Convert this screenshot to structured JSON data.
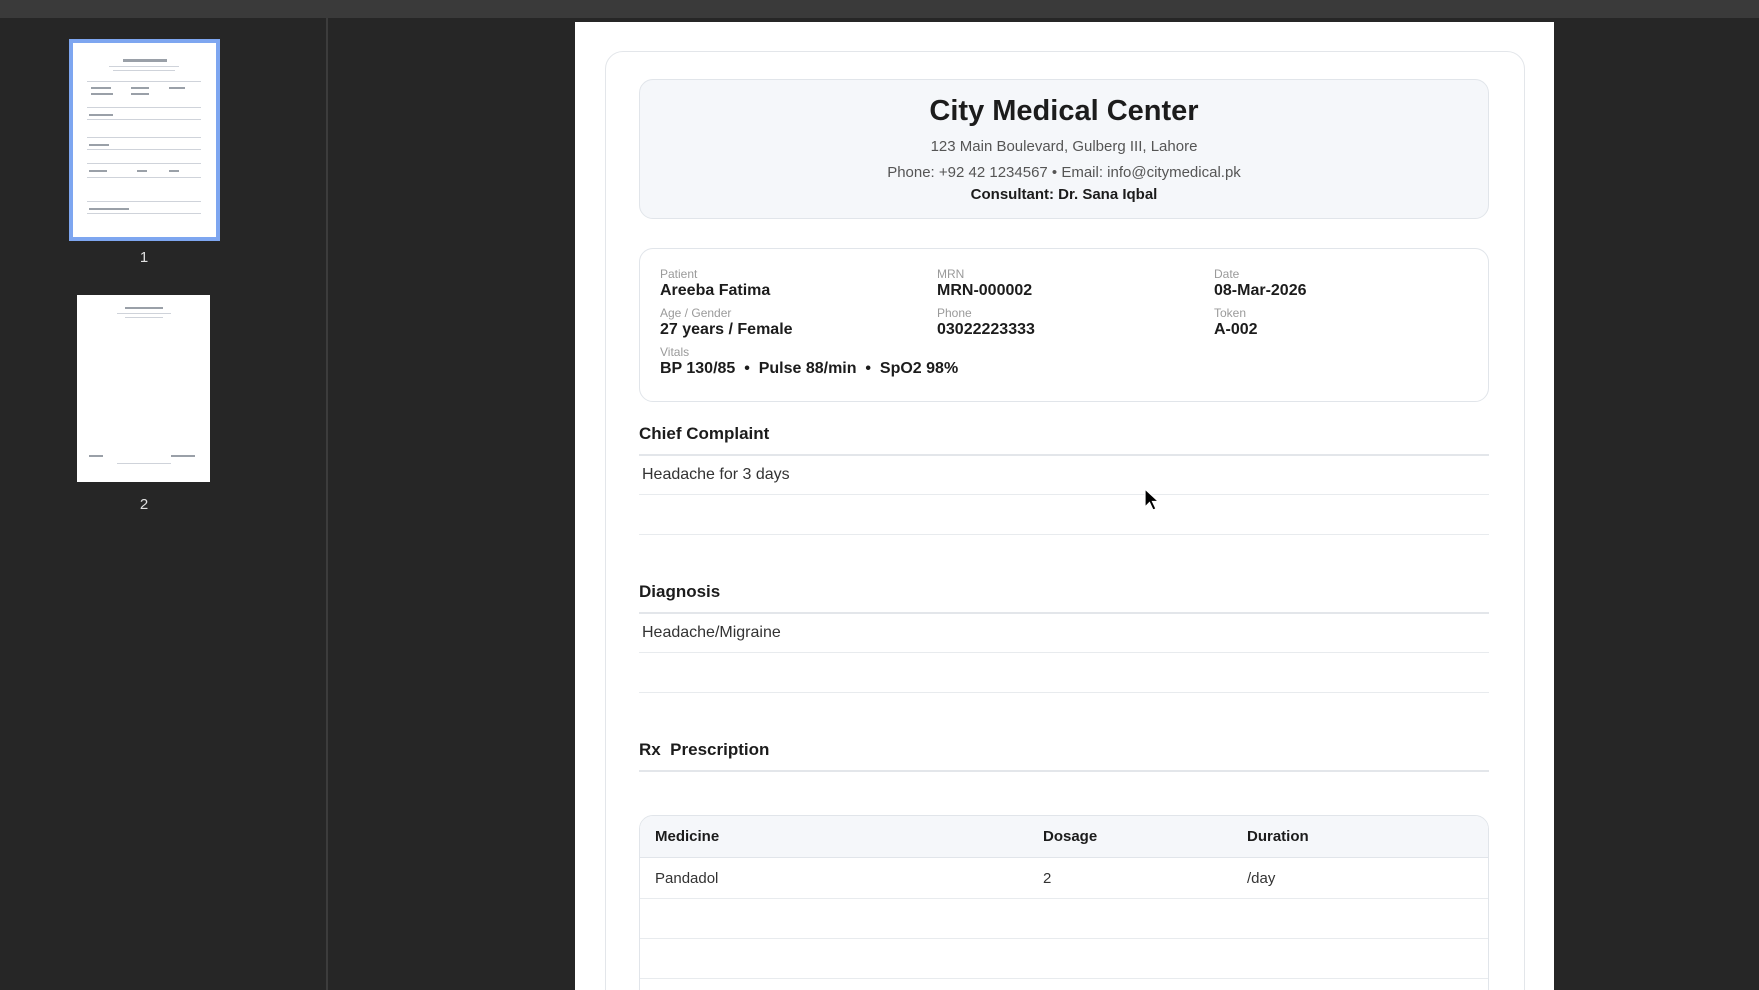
{
  "sidebar": {
    "thumbnails": [
      {
        "page_label": "1",
        "selected": true
      },
      {
        "page_label": "2",
        "selected": false
      }
    ]
  },
  "document": {
    "header": {
      "name": "City Medical Center",
      "address": "123 Main Boulevard, Gulberg III, Lahore",
      "contact": "Phone: +92 42 1234567  •  Email: info@citymedical.pk",
      "consultant": "Consultant: Dr. Sana Iqbal"
    },
    "patient": {
      "patient_label": "Patient",
      "patient_value": "Areeba Fatima",
      "mrn_label": "MRN",
      "mrn_value": "MRN-000002",
      "date_label": "Date",
      "date_value": "08-Mar-2026",
      "age_label": "Age / Gender",
      "age_value": "27 years / Female",
      "phone_label": "Phone",
      "phone_value": "03022223333",
      "token_label": "Token",
      "token_value": "A-002",
      "vitals_label": "Vitals",
      "vitals_value": "BP 130/85  •  Pulse 88/min  •  SpO2 98%"
    },
    "complaint": {
      "title": "Chief Complaint",
      "text": "Headache for 3 days"
    },
    "diagnosis": {
      "title": "Diagnosis",
      "text": "Headache/Migraine"
    },
    "prescription": {
      "title": "Rx  Prescription",
      "columns": [
        "Medicine",
        "Dosage",
        "Duration"
      ],
      "rows": [
        {
          "medicine": "Pandadol",
          "dosage": "2",
          "duration": "/day"
        }
      ]
    }
  },
  "colors": {
    "accent": "#7ea6f0",
    "viewer_bg": "#262626"
  }
}
